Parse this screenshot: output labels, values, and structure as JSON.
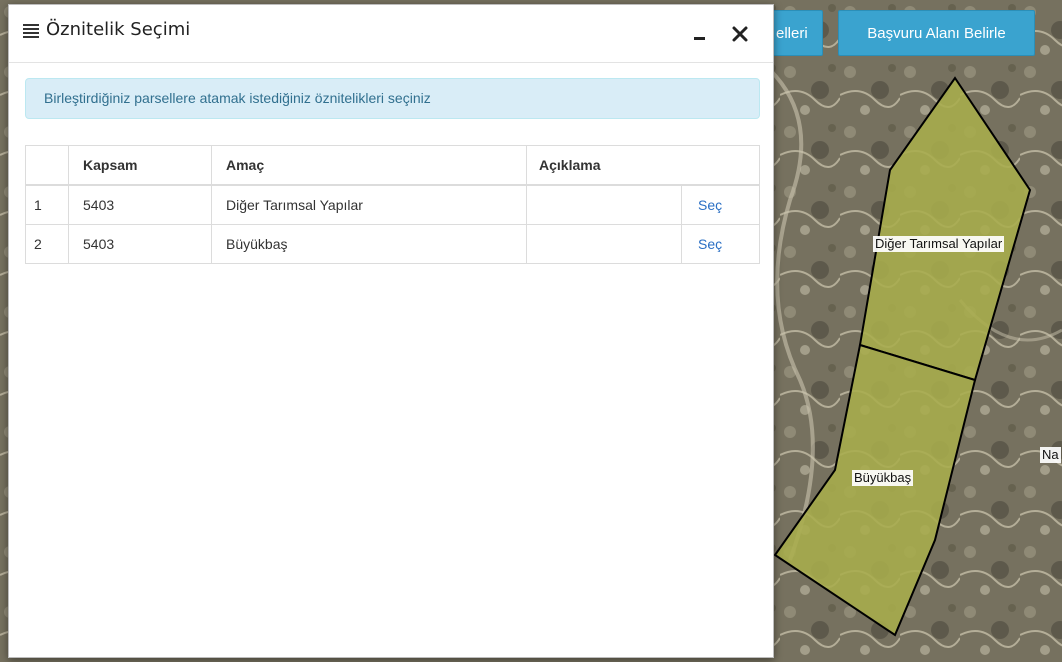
{
  "map": {
    "buttons": {
      "parcels_label": "elleri",
      "apply_area_label": "Başvuru Alanı Belirle"
    },
    "labels": {
      "diger": "Diğer Tarımsal Yapılar",
      "buyukbas": "Büyükbaş",
      "partial": "Na"
    },
    "colors": {
      "parcel_fill": "#a9ad4c",
      "button": "#3aa3cf"
    }
  },
  "dialog": {
    "menu_icon": "hamburger-icon",
    "title": "Öznitelik Seçimi",
    "minimize_icon": "minimize-icon",
    "close_icon": "close-icon",
    "info_text": "Birleştirdiğiniz parsellere atamak istediğiniz öznitelikleri seçiniz",
    "table": {
      "headers": [
        "",
        "Kapsam",
        "Amaç",
        "Açıklama",
        ""
      ],
      "rows": [
        {
          "no": "1",
          "kapsam": "5403",
          "amac": "Diğer Tarımsal Yapılar",
          "aciklama": "",
          "action": "Seç"
        },
        {
          "no": "2",
          "kapsam": "5403",
          "amac": "Büyükbaş",
          "aciklama": "",
          "action": "Seç"
        }
      ]
    }
  }
}
